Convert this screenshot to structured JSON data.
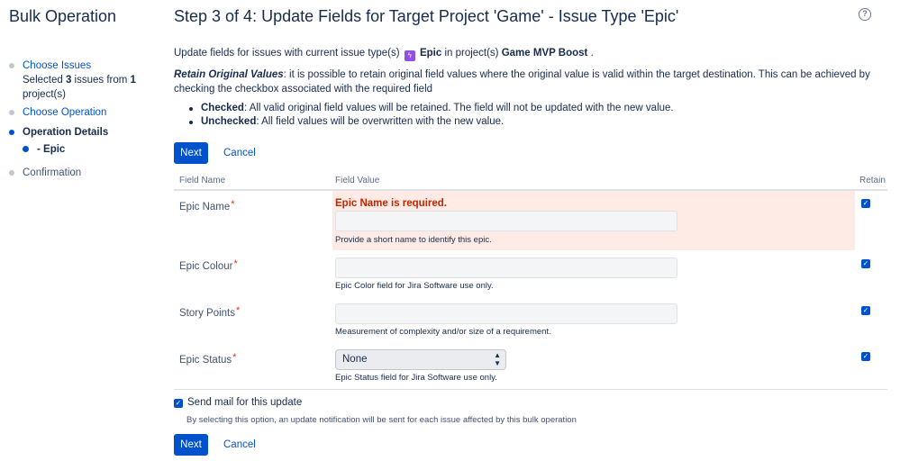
{
  "sidebar": {
    "title": "Bulk Operation",
    "steps": {
      "choose_issues": "Choose Issues",
      "selected_prefix": "Selected ",
      "selected_count": "3",
      "selected_mid": " issues from ",
      "project_count": "1",
      "selected_suffix": "project(s)",
      "choose_operation": "Choose Operation",
      "operation_details": "Operation Details",
      "epic_sub": "- Epic",
      "confirmation": "Confirmation"
    }
  },
  "header": {
    "title": "Step 3 of 4: Update Fields for Target Project 'Game' - Issue Type 'Epic'",
    "help_icon": "?"
  },
  "description": {
    "prefix": "Update fields for issues with current issue type(s) ",
    "issue_type": "Epic",
    "mid": " in project(s) ",
    "project": "Game MVP Boost",
    "suffix": " ."
  },
  "retain": {
    "label": "Retain Original Values",
    "text": ": it is possible to retain original field values where the original value is valid within the target destination. This can be achieved by checking the checkbox associated with the required field",
    "checked_label": "Checked",
    "checked_text": ": All valid original field values will be retained. The field will not be updated with the new value.",
    "unchecked_label": "Unchecked",
    "unchecked_text": ": All field values will be overwritten with the new value."
  },
  "buttons": {
    "next": "Next",
    "cancel": "Cancel"
  },
  "table": {
    "headers": {
      "field_name": "Field Name",
      "field_value": "Field Value",
      "retain": "Retain"
    },
    "rows": [
      {
        "name": "Epic Name",
        "required": "*",
        "error": "Epic Name is required.",
        "help": "Provide a short name to identify this epic.",
        "retain": true
      },
      {
        "name": "Epic Colour",
        "required": "*",
        "help": "Epic Color field for Jira Software use only.",
        "retain": true
      },
      {
        "name": "Story Points",
        "required": "*",
        "help": "Measurement of complexity and/or size of a requirement.",
        "retain": true
      },
      {
        "name": "Epic Status",
        "required": "*",
        "select_value": "None",
        "help": "Epic Status field for Jira Software use only.",
        "retain": true
      }
    ]
  },
  "mail": {
    "label": "Send mail for this update",
    "checked": true,
    "description": "By selecting this option, an update notification will be sent for each issue affected by this bulk operation"
  },
  "colors": {
    "primary": "#0052cc",
    "error_bg": "#ffebe6",
    "error_text": "#bf2600",
    "epic": "#904ee2"
  }
}
